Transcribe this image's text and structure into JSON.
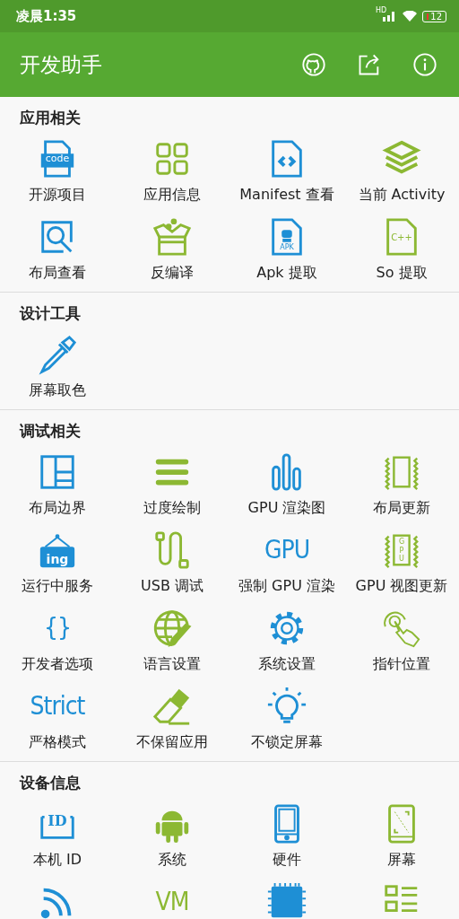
{
  "status_bar": {
    "time": "凌晨1:35",
    "network": "HD",
    "battery": "12"
  },
  "app_bar": {
    "title": "开发助手"
  },
  "sections": [
    {
      "title": "应用相关",
      "items": [
        {
          "label": "开源项目",
          "kind": "code-doc",
          "color": "#1e8fd5",
          "icon_text": "code"
        },
        {
          "label": "应用信息",
          "kind": "grid",
          "color": "#8cb833"
        },
        {
          "label": "Manifest 查看",
          "kind": "xml-doc",
          "color": "#1e8fd5"
        },
        {
          "label": "当前 Activity",
          "kind": "layers",
          "color": "#8cb833"
        },
        {
          "label": "布局查看",
          "kind": "search-box",
          "color": "#1e8fd5"
        },
        {
          "label": "反编译",
          "kind": "box",
          "color": "#8cb833"
        },
        {
          "label": "Apk 提取",
          "kind": "apk-doc",
          "color": "#1e8fd5",
          "icon_text": "APK"
        },
        {
          "label": "So 提取",
          "kind": "cpp-doc",
          "color": "#8cb833",
          "icon_text": "C++"
        }
      ]
    },
    {
      "title": "设计工具",
      "items": [
        {
          "label": "屏幕取色",
          "kind": "dropper",
          "color": "#1e8fd5"
        }
      ]
    },
    {
      "title": "调试相关",
      "items": [
        {
          "label": "布局边界",
          "kind": "layout",
          "color": "#1e8fd5"
        },
        {
          "label": "过度绘制",
          "kind": "bars",
          "color": "#8cb833"
        },
        {
          "label": "GPU 渲染图",
          "kind": "bar-chart",
          "color": "#1e8fd5"
        },
        {
          "label": "布局更新",
          "kind": "wave-rect",
          "color": "#8cb833"
        },
        {
          "label": "运行中服务",
          "kind": "sign",
          "color": "#1e8fd5",
          "icon_text": "ing"
        },
        {
          "label": "USB 调试",
          "kind": "usb",
          "color": "#8cb833"
        },
        {
          "label": "强制 GPU 渲染",
          "kind": "text",
          "color": "#1e8fd5",
          "icon_text": "GPU"
        },
        {
          "label": "GPU 视图更新",
          "kind": "wave-chip",
          "color": "#8cb833",
          "icon_text": "GPU"
        },
        {
          "label": "开发者选项",
          "kind": "text",
          "color": "#1e8fd5",
          "icon_text": "{}"
        },
        {
          "label": "语言设置",
          "kind": "globe",
          "color": "#8cb833"
        },
        {
          "label": "系统设置",
          "kind": "gear",
          "color": "#1e8fd5"
        },
        {
          "label": "指针位置",
          "kind": "pointer",
          "color": "#8cb833"
        },
        {
          "label": "严格模式",
          "kind": "text",
          "color": "#1e8fd5",
          "icon_text": "Strict"
        },
        {
          "label": "不保留应用",
          "kind": "eraser",
          "color": "#8cb833"
        },
        {
          "label": "不锁定屏幕",
          "kind": "bulb",
          "color": "#1e8fd5"
        }
      ]
    },
    {
      "title": "设备信息",
      "items": [
        {
          "label": "本机 ID",
          "kind": "id",
          "color": "#1e8fd5",
          "icon_text": "ID"
        },
        {
          "label": "系统",
          "kind": "android",
          "color": "#8cb833"
        },
        {
          "label": "硬件",
          "kind": "phone",
          "color": "#1e8fd5"
        },
        {
          "label": "屏幕",
          "kind": "screen",
          "color": "#8cb833"
        },
        {
          "kind": "wifi",
          "color": "#1e8fd5"
        },
        {
          "kind": "text",
          "color": "#8cb833",
          "icon_text": "VM"
        },
        {
          "kind": "chip",
          "color": "#1e8fd5"
        },
        {
          "kind": "list",
          "color": "#8cb833"
        }
      ]
    }
  ]
}
